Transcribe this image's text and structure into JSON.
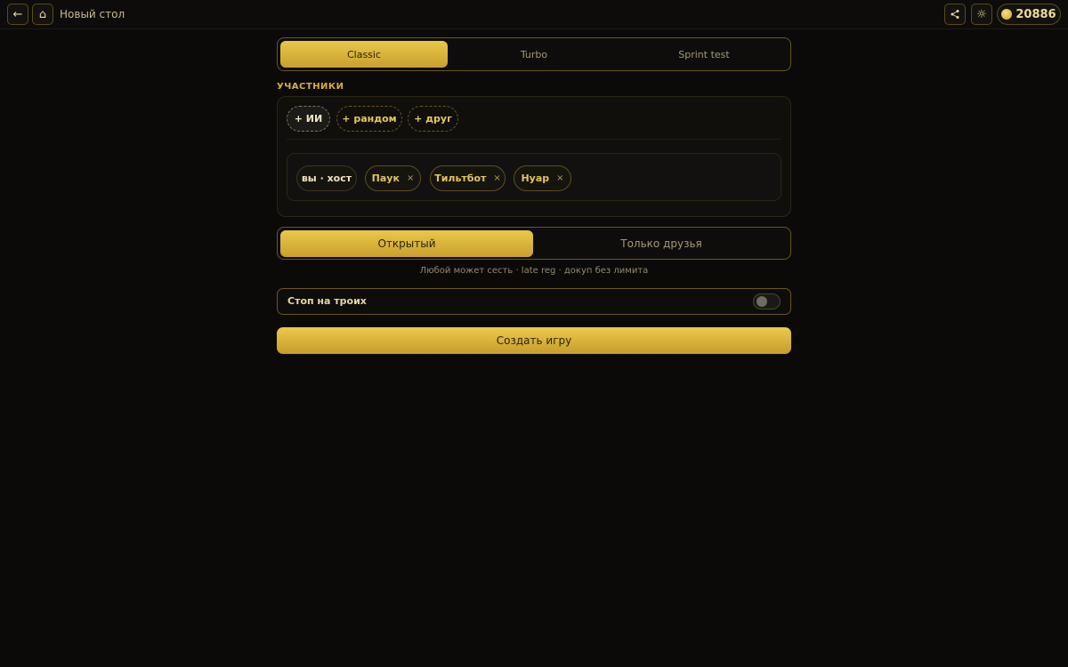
{
  "header": {
    "title": "Новый стол",
    "back_icon": "←",
    "home_icon": "⌂",
    "share_icon": "<",
    "theme_icon": "☼",
    "coins": "20886"
  },
  "modes": {
    "items": [
      {
        "label": "Classic",
        "active": true
      },
      {
        "label": "Turbo",
        "active": false
      },
      {
        "label": "Sprint test",
        "active": false
      }
    ]
  },
  "participants": {
    "section_label": "УЧАСТНИКИ",
    "add_buttons": [
      "+ ИИ",
      "+ рандом",
      "+ друг"
    ],
    "seats": [
      {
        "label": "вы · хост",
        "removable": false
      },
      {
        "label": "Паук",
        "removable": true
      },
      {
        "label": "Тильтбот",
        "removable": true
      },
      {
        "label": "Нуар",
        "removable": true
      }
    ],
    "remove_glyph": "×"
  },
  "access": {
    "items": [
      {
        "label": "Открытый",
        "active": true
      },
      {
        "label": "Только друзья",
        "active": false
      }
    ],
    "hint": "Любой может сесть · late reg · докуп без лимита"
  },
  "stop_three": {
    "label": "Стоп на троих",
    "enabled": false
  },
  "create_button": "Создать игру",
  "colors": {
    "accent": "#e4bf45",
    "background": "#0b0a09",
    "border": "#6a5620"
  }
}
